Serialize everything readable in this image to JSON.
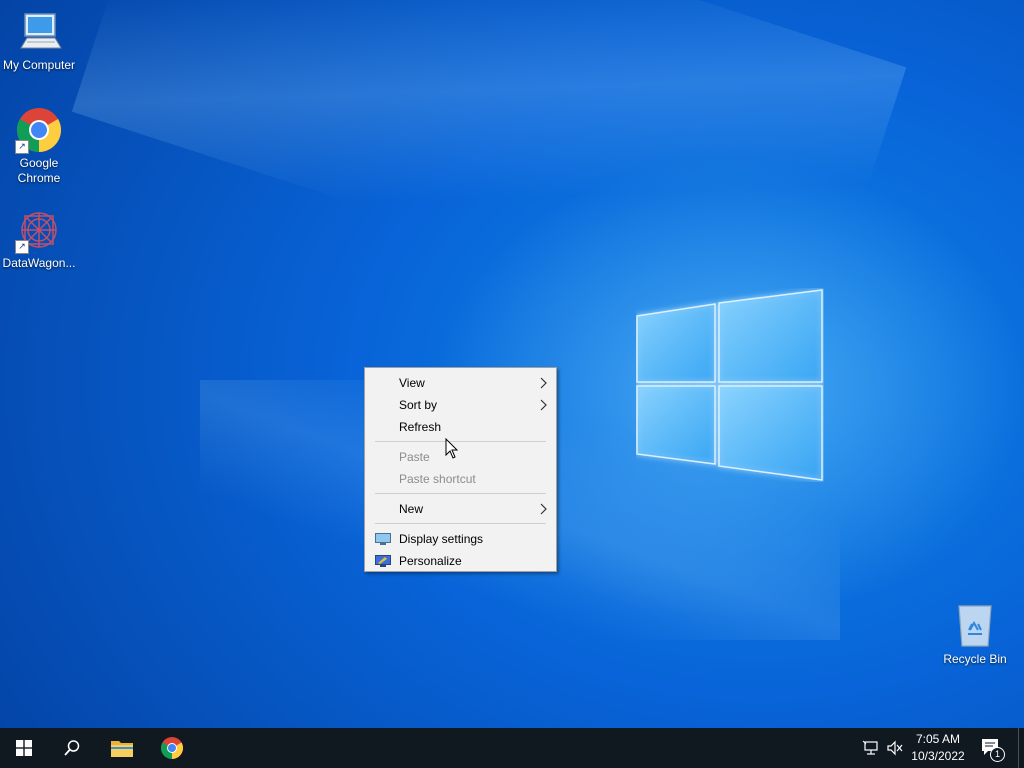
{
  "desktop": {
    "icons": [
      {
        "label": "My Computer",
        "icon": "computer-icon"
      },
      {
        "label": "Google\nChrome",
        "icon": "chrome-icon"
      },
      {
        "label": "DataWagon...",
        "icon": "datawagon-icon"
      },
      {
        "label": "Recycle Bin",
        "icon": "recycle-bin-icon"
      }
    ]
  },
  "context_menu": {
    "items": [
      {
        "label": "View",
        "has_submenu": true,
        "enabled": true
      },
      {
        "label": "Sort by",
        "has_submenu": true,
        "enabled": true
      },
      {
        "label": "Refresh",
        "has_submenu": false,
        "enabled": true
      },
      {
        "label": "Paste",
        "has_submenu": false,
        "enabled": false
      },
      {
        "label": "Paste shortcut",
        "has_submenu": false,
        "enabled": false
      },
      {
        "label": "New",
        "has_submenu": true,
        "enabled": true
      },
      {
        "label": "Display settings",
        "icon": "display-settings-icon",
        "enabled": true
      },
      {
        "label": "Personalize",
        "icon": "personalize-icon",
        "enabled": true
      }
    ]
  },
  "taskbar": {
    "buttons": [
      {
        "name": "start",
        "icon": "windows-start-icon"
      },
      {
        "name": "search",
        "icon": "search-icon"
      },
      {
        "name": "file-explorer",
        "icon": "folder-icon"
      },
      {
        "name": "chrome",
        "icon": "chrome-icon"
      }
    ],
    "clock": {
      "time": "7:05 AM",
      "date": "10/3/2022"
    },
    "notification_count": "1"
  },
  "colors": {
    "taskbar": "#101820",
    "menu_bg": "#f2f2f2",
    "disabled_text": "#8c8c8c"
  }
}
